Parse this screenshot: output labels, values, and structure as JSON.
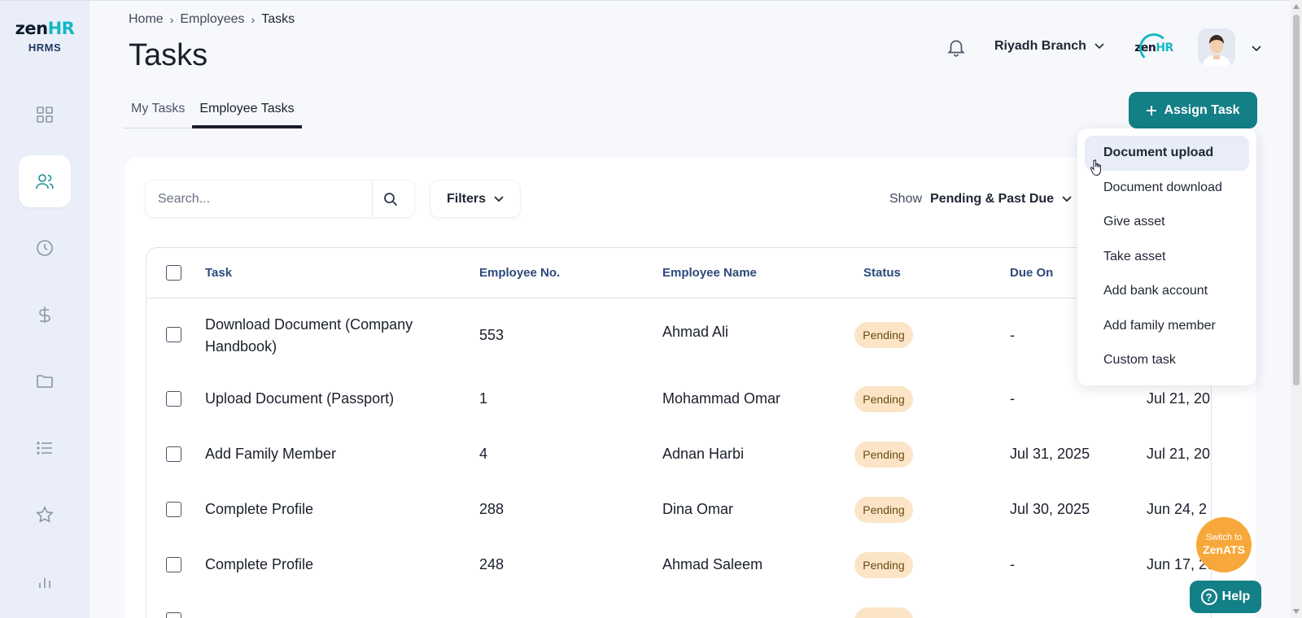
{
  "app": {
    "logo_brand_prefix": "zen",
    "logo_brand_suffix": "HR",
    "logo_product": "HRMS"
  },
  "sidebar": {
    "items": [
      {
        "name": "dashboard",
        "icon": "grid-icon",
        "active": false
      },
      {
        "name": "employees",
        "icon": "users-icon",
        "active": true
      },
      {
        "name": "time",
        "icon": "clock-icon",
        "active": false
      },
      {
        "name": "payroll",
        "icon": "dollar-icon",
        "active": false
      },
      {
        "name": "documents",
        "icon": "folder-icon",
        "active": false
      },
      {
        "name": "lists",
        "icon": "list-icon",
        "active": false
      },
      {
        "name": "performance",
        "icon": "star-icon",
        "active": false
      },
      {
        "name": "reports",
        "icon": "bar-chart-icon",
        "active": false
      }
    ]
  },
  "breadcrumb": [
    "Home",
    "Employees",
    "Tasks"
  ],
  "page_title": "Tasks",
  "header": {
    "notifications_icon": "bell-icon",
    "branch": "Riyadh Branch",
    "company_logo_prefix": "zen",
    "company_logo_suffix": "HR"
  },
  "tabs": [
    {
      "label": "My Tasks",
      "active": false
    },
    {
      "label": "Employee Tasks",
      "active": true
    }
  ],
  "assign_button": "Assign Task",
  "assign_menu": [
    "Document upload",
    "Document download",
    "Give asset",
    "Take asset",
    "Add bank account",
    "Add family member",
    "Custom task"
  ],
  "toolbar": {
    "search_placeholder": "Search...",
    "filters_label": "Filters",
    "show_label": "Show",
    "show_value": "Pending & Past Due"
  },
  "table": {
    "columns": [
      "Task",
      "Employee No.",
      "Employee Name",
      "Status",
      "Due On"
    ],
    "rows": [
      {
        "task_line1": "Download Document (Company",
        "task_line2": "Handbook)",
        "emp_no": "553",
        "emp_name": "Ahmad Ali",
        "status": "Pending",
        "due_on": "-",
        "extra": ""
      },
      {
        "task_line1": "Upload Document (Passport)",
        "task_line2": "",
        "emp_no": "1",
        "emp_name": "Mohammad Omar",
        "status": "Pending",
        "due_on": "-",
        "extra": "Jul 21, 20"
      },
      {
        "task_line1": "Add Family Member",
        "task_line2": "",
        "emp_no": "4",
        "emp_name": "Adnan Harbi",
        "status": "Pending",
        "due_on": "Jul 31, 2025",
        "extra": "Jul 21, 20"
      },
      {
        "task_line1": "Complete Profile",
        "task_line2": "",
        "emp_no": "288",
        "emp_name": "Dina Omar",
        "status": "Pending",
        "due_on": "Jul 30, 2025",
        "extra": "Jun 24, 2"
      },
      {
        "task_line1": "Complete Profile",
        "task_line2": "",
        "emp_no": "248",
        "emp_name": "Ahmad Saleem",
        "status": "Pending",
        "due_on": "-",
        "extra": "Jun 17, 20"
      }
    ]
  },
  "floating": {
    "switch_line1": "Switch to",
    "switch_line2": "ZenATS",
    "help": "Help"
  },
  "colors": {
    "primary": "#137f86",
    "accent": "#16b8c2",
    "sidebar_bg": "#eaeef8",
    "pending_badge": "#fbe5c6",
    "switch_ats": "#f7a83a"
  }
}
